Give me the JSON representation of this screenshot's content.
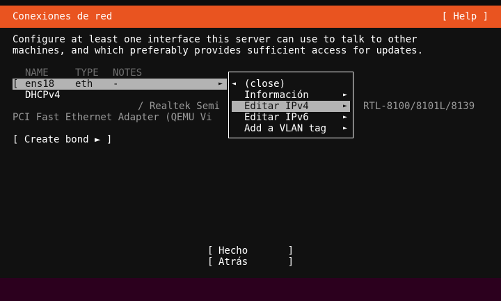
{
  "header": {
    "title": "Conexiones de red",
    "help": "[ Help ]"
  },
  "description": {
    "line1": "Configure at least one interface this server can use to talk to other",
    "line2": "machines, and which preferably provides sufficient access for updates."
  },
  "table": {
    "columns": [
      "NAME",
      "TYPE",
      "NOTES"
    ],
    "interface": {
      "bracket": "[",
      "name": "ens18",
      "type": "eth",
      "notes": "-",
      "arrow": "►"
    },
    "address": "DHCPv4",
    "vendor_line1_left": "/ Realtek Semi",
    "vendor_line1_right": "RTL-8100/8101L/8139",
    "vendor_line2": "PCI Fast Ethernet Adapter (QEMU Vi"
  },
  "create_bond": "[ Create bond ► ]",
  "menu": {
    "items": [
      {
        "label": "(close)",
        "left_arrow": "◄",
        "arrow": ""
      },
      {
        "label": "Información",
        "left_arrow": "",
        "arrow": "►"
      },
      {
        "label": "Editar IPv4",
        "left_arrow": "",
        "arrow": "►"
      },
      {
        "label": "Editar IPv6",
        "left_arrow": "",
        "arrow": "►"
      },
      {
        "label": "Add a VLAN tag",
        "left_arrow": "",
        "arrow": "►"
      }
    ],
    "selected_index": 2
  },
  "buttons": {
    "done": "Hecho",
    "back": "Atrás",
    "open": "[",
    "close": "]"
  },
  "colors": {
    "accent": "#e95420",
    "background": "#111111",
    "selection": "#b3b3b3",
    "muted": "#6f6f6f"
  }
}
